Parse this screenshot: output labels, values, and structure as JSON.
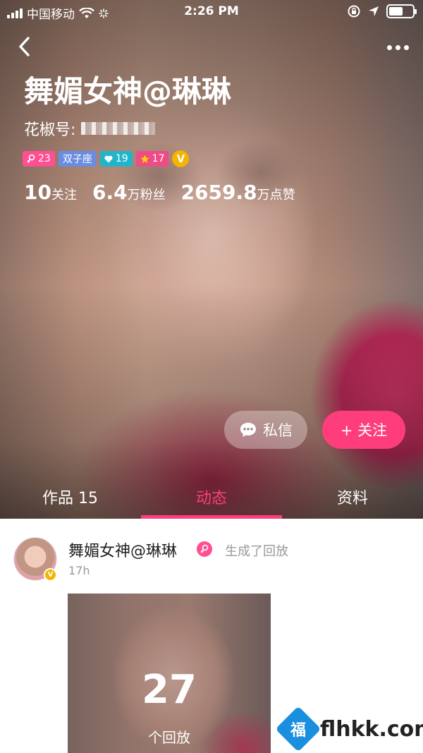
{
  "status_bar": {
    "carrier": "中国移动",
    "time": "2:26 PM",
    "battery_level": 0.6
  },
  "profile": {
    "name": "舞媚女神@琳琳",
    "account_label": "花椒号:",
    "badges": {
      "gender_level": "23",
      "zodiac": "双子座",
      "heart_level": "19",
      "star_level": "17",
      "verified": "V"
    },
    "stats": {
      "following_value": "10",
      "following_label": "关注",
      "fans_value": "6.4",
      "fans_label": "万粉丝",
      "likes_value": "2659.8",
      "likes_label": "万点赞"
    },
    "message_button": "私信",
    "follow_button": "+ 关注"
  },
  "tabs": {
    "works": "作品 15",
    "activity": "动态",
    "profile": "资料",
    "active": "activity"
  },
  "feed": {
    "post": {
      "author": "舞媚女神@琳琳",
      "action": "生成了回放",
      "time": "17h",
      "replay_count": "27",
      "replay_label": "个回放"
    }
  },
  "watermark": {
    "logo_char": "福",
    "text": "flhkk.com"
  },
  "icons": {
    "back": "chevron-left-icon",
    "more": "more-dots-icon",
    "wifi": "wifi-icon",
    "location": "location-arrow-icon",
    "rotation_lock": "rotation-lock-icon",
    "chat": "chat-bubble-icon"
  },
  "colors": {
    "accent": "#fe3e7c",
    "gender_badge": "#ff4f93",
    "zodiac_badge": "#6a8de0",
    "heart_badge": "#22b5c9",
    "star_badge": "#ef4b86",
    "verified": "#f5b400"
  }
}
